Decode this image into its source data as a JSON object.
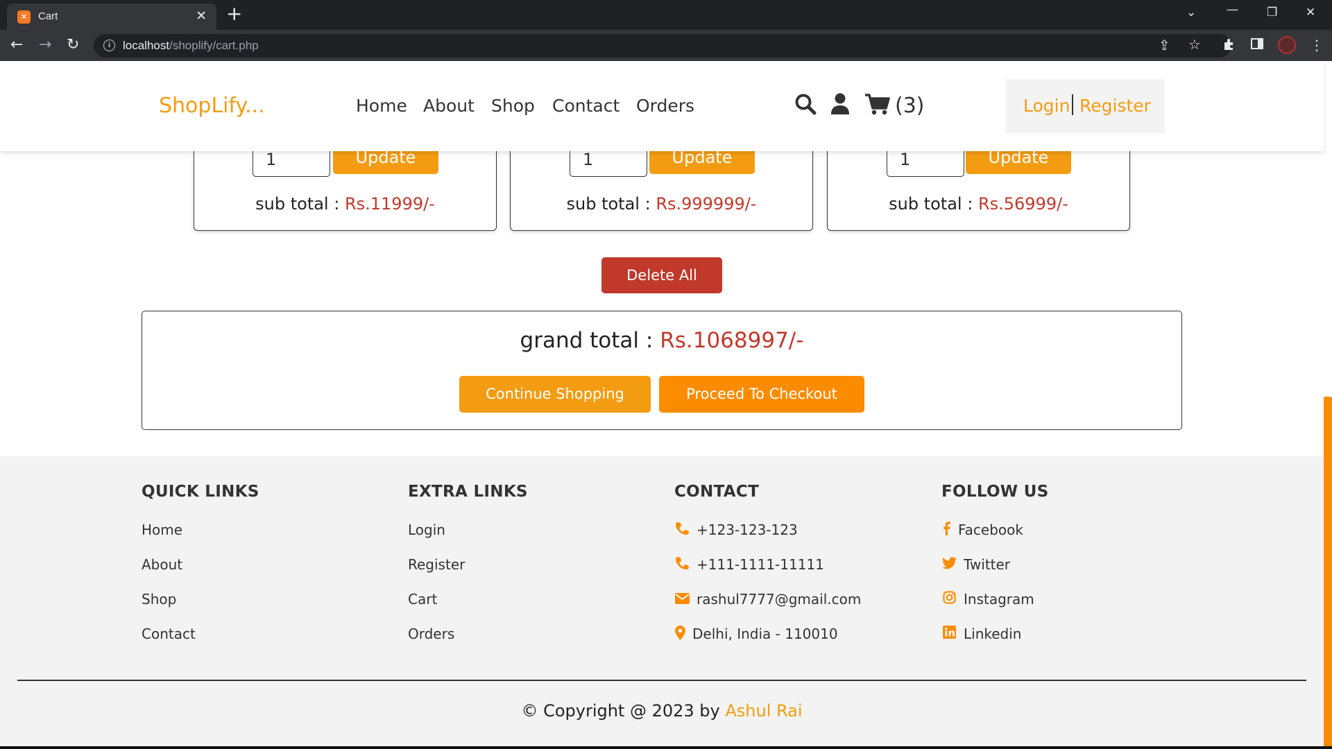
{
  "browser": {
    "tab_title": "Cart",
    "favicon_text": "✕",
    "url_host": "localhost",
    "url_path": "/shoplify/cart.php"
  },
  "header": {
    "logo": "ShopLify...",
    "nav": [
      "Home",
      "About",
      "Shop",
      "Contact",
      "Orders"
    ],
    "cart_count": "(3)",
    "login": "Login",
    "register": "Register"
  },
  "cart": {
    "items": [
      {
        "qty": "1",
        "update_label": "Update",
        "subtotal_label": "sub total : ",
        "subtotal_value": "Rs.11999/-"
      },
      {
        "qty": "1",
        "update_label": "Update",
        "subtotal_label": "sub total : ",
        "subtotal_value": "Rs.999999/-"
      },
      {
        "qty": "1",
        "update_label": "Update",
        "subtotal_label": "sub total : ",
        "subtotal_value": "Rs.56999/-"
      }
    ],
    "delete_all": "Delete All",
    "grand_total_label": "grand total : ",
    "grand_total_value": "Rs.1068997/-",
    "continue_shopping": "Continue Shopping",
    "proceed_checkout": "Proceed To Checkout"
  },
  "footer": {
    "quick_links": {
      "title": "QUICK LINKS",
      "items": [
        "Home",
        "About",
        "Shop",
        "Contact"
      ]
    },
    "extra_links": {
      "title": "EXTRA LINKS",
      "items": [
        "Login",
        "Register",
        "Cart",
        "Orders"
      ]
    },
    "contact": {
      "title": "CONTACT",
      "items": [
        {
          "icon": "phone-icon",
          "text": "+123-123-123"
        },
        {
          "icon": "phone-icon",
          "text": "+111-1111-11111"
        },
        {
          "icon": "envelope-icon",
          "text": "rashul7777@gmail.com"
        },
        {
          "icon": "map-marker-icon",
          "text": "Delhi, India - 110010"
        }
      ]
    },
    "follow_us": {
      "title": "FOLLOW US",
      "items": [
        {
          "icon": "facebook-icon",
          "text": "Facebook"
        },
        {
          "icon": "twitter-icon",
          "text": "Twitter"
        },
        {
          "icon": "instagram-icon",
          "text": "Instagram"
        },
        {
          "icon": "linkedin-icon",
          "text": "Linkedin"
        }
      ]
    },
    "copyright_prefix": "© Copyright @ 2023 by ",
    "author": "Ashul Rai"
  },
  "colors": {
    "accent": "#f39c12",
    "checkout": "#fb8c00",
    "danger": "#c0392b",
    "footer_bg": "#f3f3f3"
  }
}
